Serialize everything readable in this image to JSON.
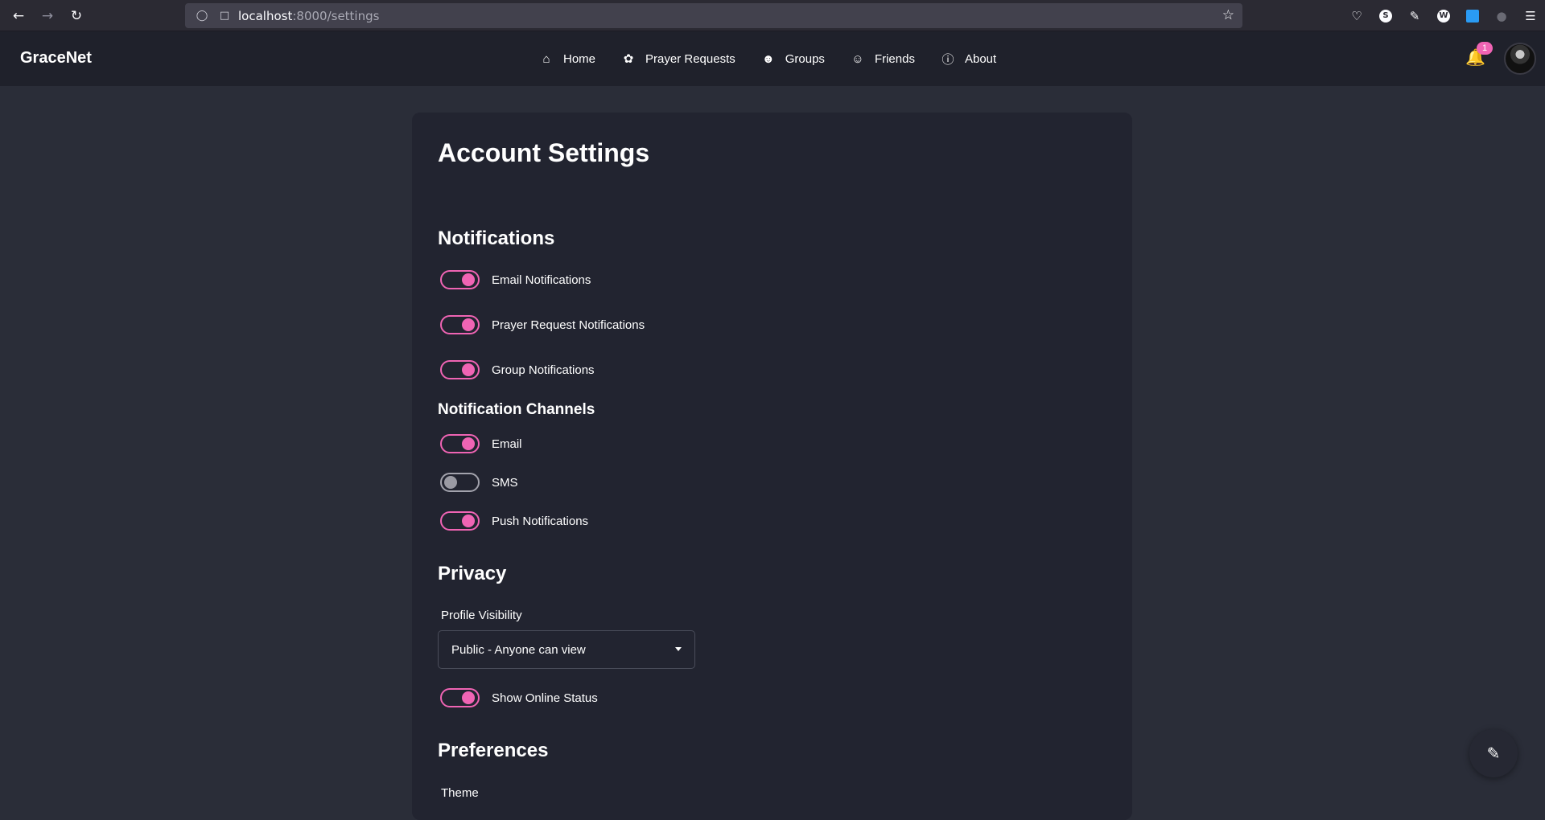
{
  "browser": {
    "back_icon": "arrow-left-icon",
    "forward_icon": "arrow-right-icon",
    "reload_icon": "reload-icon",
    "url_host": "localhost",
    "url_path": ":8000/settings"
  },
  "app": {
    "brand": "GraceNet",
    "nav": [
      {
        "label": "Home",
        "icon": "home-icon"
      },
      {
        "label": "Prayer Requests",
        "icon": "praying-icon"
      },
      {
        "label": "Groups",
        "icon": "users-icon"
      },
      {
        "label": "Friends",
        "icon": "user-friends-icon"
      },
      {
        "label": "About",
        "icon": "info-icon"
      }
    ],
    "notification_count": "1"
  },
  "settings": {
    "title": "Account Settings",
    "notifications": {
      "heading": "Notifications",
      "email": "Email Notifications",
      "prayer": "Prayer Request Notifications",
      "group": "Group Notifications"
    },
    "channels": {
      "heading": "Notification Channels",
      "email": "Email",
      "sms": "SMS",
      "push": "Push Notifications"
    },
    "privacy": {
      "heading": "Privacy",
      "visibility_label": "Profile Visibility",
      "visibility_value": "Public - Anyone can view",
      "online_status": "Show Online Status"
    },
    "preferences": {
      "heading": "Preferences",
      "theme_label": "Theme"
    }
  },
  "colors": {
    "accent": "#f064b4",
    "background": "#2a2d38",
    "card": "#222430",
    "navbar": "#1f212b"
  }
}
